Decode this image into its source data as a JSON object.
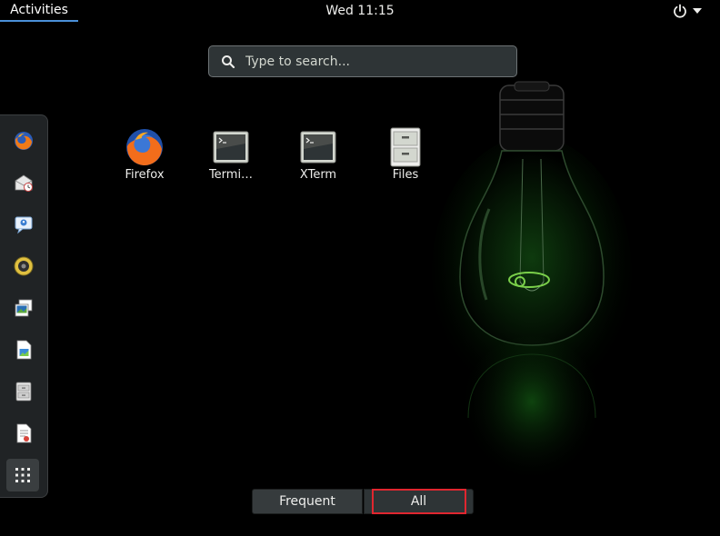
{
  "topbar": {
    "activities_label": "Activities",
    "clock": "Wed 11:15",
    "power_icon": "power-icon",
    "menu_icon": "caret-down-icon"
  },
  "search": {
    "placeholder": "Type to search...",
    "value": ""
  },
  "dash": {
    "items": [
      {
        "name": "firefox",
        "icon": "firefox-icon"
      },
      {
        "name": "mail",
        "icon": "mail-clock-icon"
      },
      {
        "name": "chat",
        "icon": "chat-icon"
      },
      {
        "name": "music",
        "icon": "speaker-icon"
      },
      {
        "name": "photos",
        "icon": "photos-icon"
      },
      {
        "name": "document",
        "icon": "document-image-icon"
      },
      {
        "name": "file-cabinet",
        "icon": "file-cabinet-icon"
      },
      {
        "name": "office",
        "icon": "office-document-icon"
      }
    ],
    "show_apps_icon": "grid-icon"
  },
  "apps": [
    {
      "label": "Firefox",
      "icon": "firefox-icon"
    },
    {
      "label": "Termi…",
      "icon": "terminal-icon"
    },
    {
      "label": "XTerm",
      "icon": "terminal-icon"
    },
    {
      "label": "Files",
      "icon": "file-cabinet-icon"
    }
  ],
  "view_switcher": {
    "frequent_label": "Frequent",
    "all_label": "All",
    "selected": "All"
  },
  "colors": {
    "accent": "#4a90d9",
    "highlight_outline": "#e0262f",
    "bulb_glow": "#2a9a2a"
  }
}
